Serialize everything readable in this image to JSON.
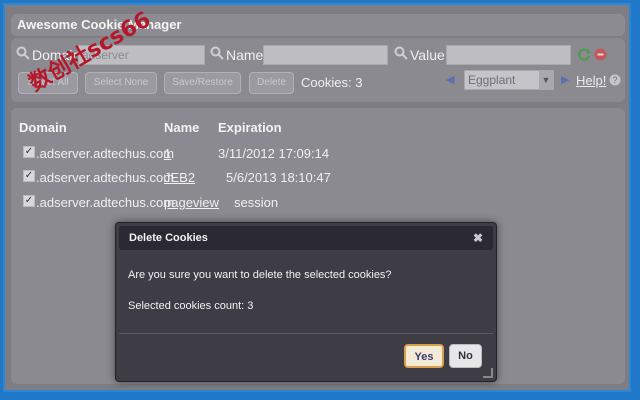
{
  "app": {
    "title": "Awesome Cookie Manager"
  },
  "search": {
    "domain_label": "Domain",
    "domain_value": "adserver",
    "name_label": "Name",
    "name_value": "",
    "value_label": "Value",
    "value_value": ""
  },
  "toolbar": {
    "select_all": "Select All",
    "select_none": "Select None",
    "save_restore": "Save/Restore",
    "delete": "Delete",
    "cookies_count": "Cookies: 3",
    "theme_selected": "Eggplant",
    "help": "Help!"
  },
  "table": {
    "headers": [
      "Domain",
      "Name",
      "Expiration"
    ],
    "rows": [
      {
        "domain": ".adserver.adtechus.com",
        "name": "1",
        "expiration": "3/11/2012 17:09:14"
      },
      {
        "domain": ".adserver.adtechus.com",
        "name": "JEB2",
        "expiration": "5/6/2013 18:10:47"
      },
      {
        "domain": ".adserver.adtechus.com",
        "name": "pageview",
        "expiration": "session"
      }
    ]
  },
  "watermark": "数创社scs66",
  "dialog": {
    "title": "Delete Cookies",
    "question": "Are you sure you want to delete the selected cookies?",
    "count_text": "Selected cookies count: 3",
    "yes": "Yes",
    "no": "No"
  },
  "colors": {
    "border_blue": "#1f78c8",
    "dialog_bg": "#3e3c44",
    "yes_border": "#d9a04a"
  },
  "icons": [
    "search-icon",
    "refresh-icon",
    "clear-icon",
    "prev-icon",
    "next-icon",
    "help-icon",
    "close-icon",
    "resize-grip-icon"
  ]
}
